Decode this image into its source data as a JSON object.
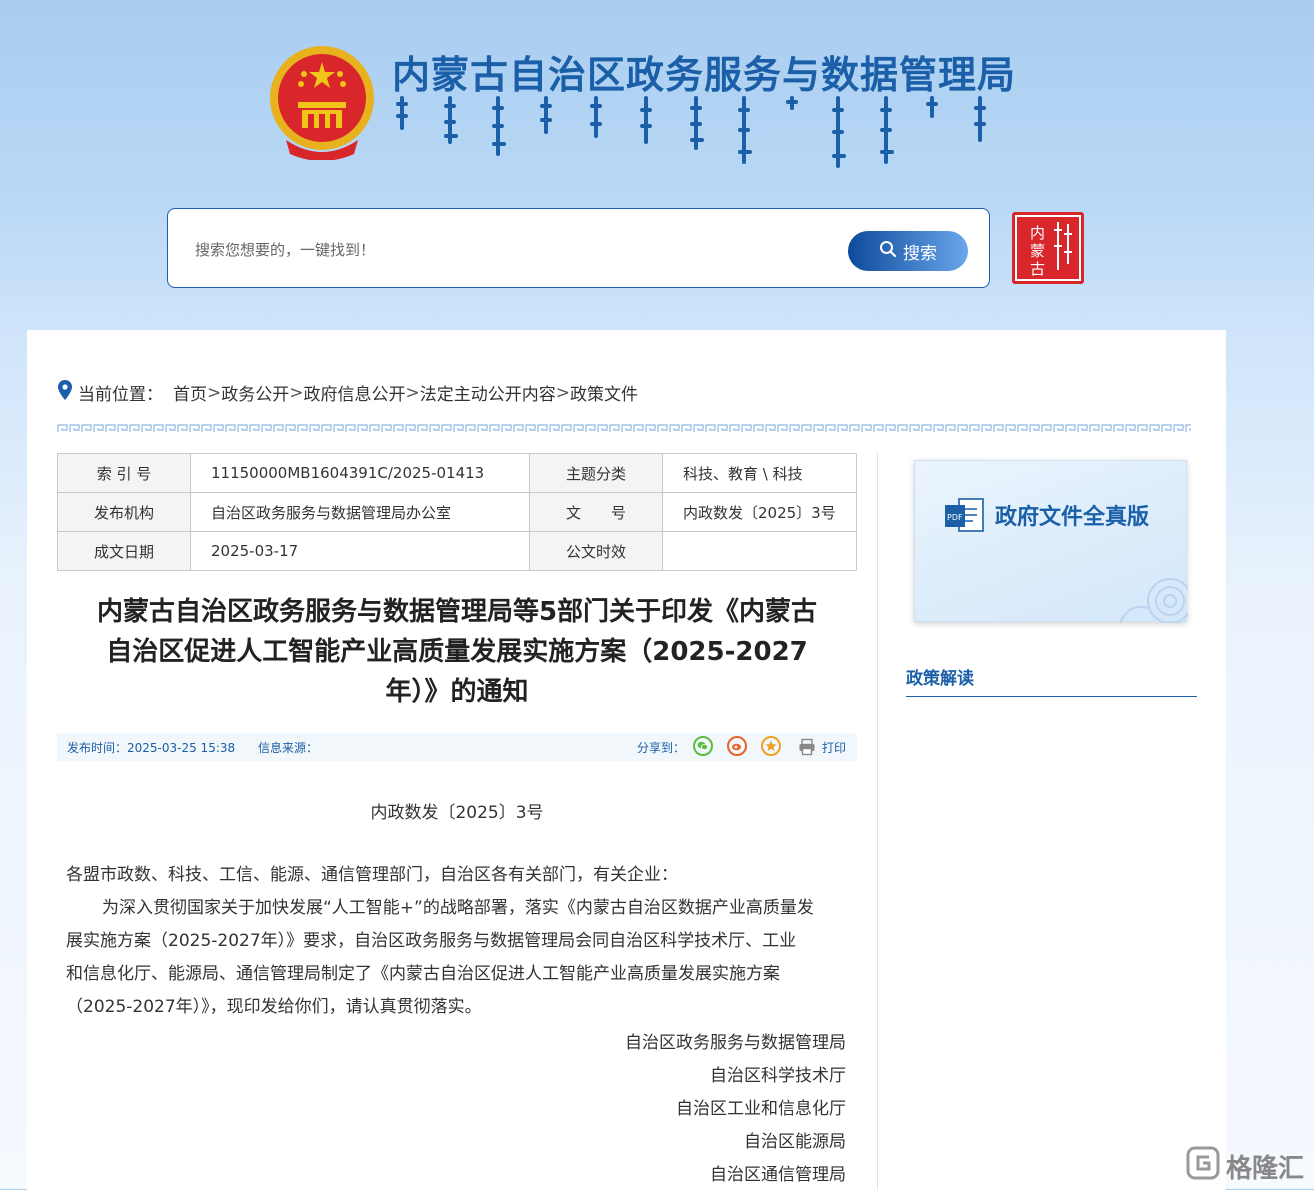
{
  "header": {
    "site_title": "内蒙古自治区政务服务与数据管理局",
    "search_placeholder": "搜索您想要的，一键找到！",
    "search_button": "搜索",
    "seal_text": "内蒙古"
  },
  "breadcrumb": {
    "label": "当前位置：",
    "items": [
      "首页",
      "政务公开",
      "政府信息公开",
      "法定主动公开内容",
      "政策文件"
    ],
    "sep": ">"
  },
  "meta_table": {
    "rows": [
      {
        "l1": "索 引 号",
        "v1": "11150000MB1604391C/2025-01413",
        "l2": "主题分类",
        "v2": "科技、教育 \\ 科技"
      },
      {
        "l1": "发布机构",
        "v1": "自治区政务服务与数据管理局办公室",
        "l2": "文　　号",
        "v2": "内政数发〔2025〕3号"
      },
      {
        "l1": "成文日期",
        "v1": "2025-03-17",
        "l2": "公文时效",
        "v2": ""
      }
    ]
  },
  "article": {
    "title_lines": [
      "内蒙古自治区政务服务与数据管理局等5部门关于印发《内蒙古",
      "自治区促进人工智能产业高质量发展实施方案（2025-2027",
      "年）》的通知"
    ],
    "publish_time": "发布时间：2025-03-25 15:38",
    "source": "信息来源：",
    "share_label": "分享到：",
    "print_label": "打印",
    "doc_number": "内政数发〔2025〕3号",
    "salutation": "各盟市政数、科技、工信、能源、通信管理部门，自治区各有关部门，有关企业：",
    "paragraph": [
      "为深入贯彻国家关于加快发展“人工智能+”的战略部署，落实《内蒙古自治区数据产业高质量发",
      "展实施方案（2025-2027年）》要求，自治区政务服务与数据管理局会同自治区科学技术厅、工业",
      "和信息化厅、能源局、通信管理局制定了《内蒙古自治区促进人工智能产业高质量发展实施方案",
      "（2025-2027年）》，现印发给你们，请认真贯彻落实。"
    ],
    "signatures": [
      "自治区政务服务与数据管理局",
      "自治区科学技术厅",
      "自治区工业和信息化厅",
      "自治区能源局",
      "自治区通信管理局"
    ]
  },
  "sidebar": {
    "fulltext_label": "政府文件全真版",
    "pdf_label": "PDF",
    "policy_title": "政策解读"
  },
  "watermark": "格隆汇",
  "colors": {
    "brand": "#1a5fa8",
    "emblem_red": "#d9262b",
    "gold": "#f0c419"
  }
}
